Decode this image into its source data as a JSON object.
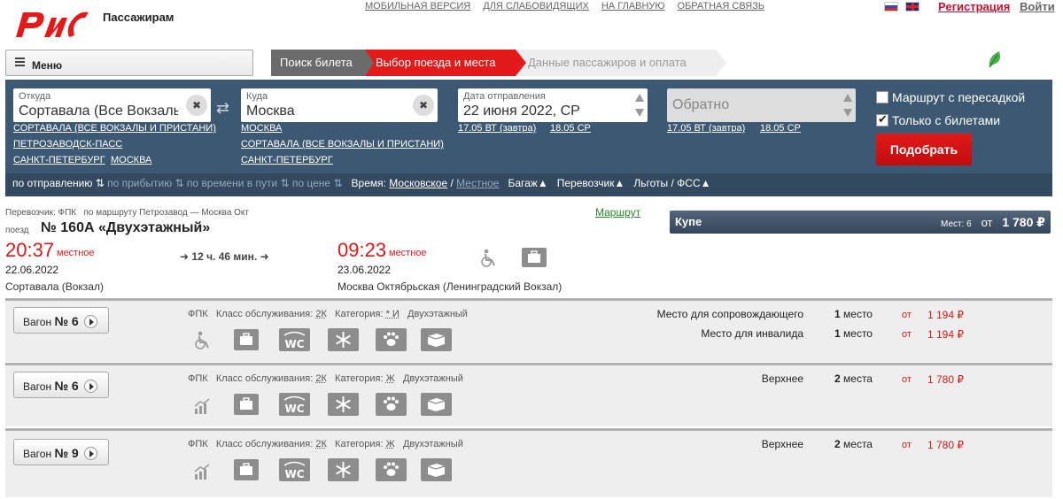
{
  "header": {
    "brand": "Пассажирам",
    "links": [
      "МОБИЛЬНАЯ ВЕРСИЯ",
      "ДЛЯ СЛАБОВИДЯЩИХ",
      "НА ГЛАВНУЮ",
      "ОБРАТНАЯ СВЯЗЬ"
    ],
    "register": "Регистрация",
    "login": "Войти",
    "menu": "Меню"
  },
  "steps": [
    "Поиск билета",
    "Выбор поезда и места",
    "Данные пассажиров и оплата"
  ],
  "search": {
    "from_label": "Откуда",
    "from_value": "Сортавала (Все Вокзалы И",
    "from_suggestions": [
      "СОРТАВАЛА (ВСЕ ВОКЗАЛЫ И ПРИСТАНИ)",
      "ПЕТРОЗАВОДСК-ПАСС",
      "САНКТ-ПЕТЕРБУРГ",
      "МОСКВА"
    ],
    "to_label": "Куда",
    "to_value": "Москва",
    "to_suggestions": [
      "МОСКВА",
      "СОРТАВАЛА (ВСЕ ВОКЗАЛЫ И ПРИСТАНИ)",
      "САНКТ-ПЕТЕРБУРГ"
    ],
    "date_label": "Дата отправления",
    "date_value": "22 июня 2022, СР",
    "date_suggestions": [
      "17.05 ВТ (завтра)",
      "18.05 СР"
    ],
    "back_placeholder": "Обратно",
    "back_suggestions": [
      "17.05 ВТ (завтра)",
      "18.05 СР"
    ],
    "transfer_label": "Маршрут с пересадкой",
    "tickets_only_label": "Только с билетами",
    "find_button": "Подобрать"
  },
  "sortbar": {
    "by_departure": "по отправлению",
    "by_arrival": "по прибытию",
    "by_travel_time": "по времени в пути",
    "by_price": "по цене",
    "time_label": "Время:",
    "time_moscow": "Московское",
    "time_local": "Местное",
    "baggage": "Багаж",
    "carrier": "Перевозчик",
    "benefits": "Льготы / ФСС"
  },
  "train": {
    "carrier_route": "Перевозчик: ФПК   по маршруту Петрозавод — Москва Окт",
    "route_link": "Маршрут",
    "train_prefix": "поезд",
    "train_name": "№ 160А «Двухэтажный»",
    "dep_time": "20:37",
    "dep_tz": "местное",
    "dep_date": "22.06.2022",
    "dep_station": "Сортавала (Вокзал)",
    "duration": "12 ч. 46 мин.",
    "arr_time": "09:23",
    "arr_tz": "местное",
    "arr_date": "23.06.2022",
    "arr_station": "Москва Октябрьская (Ленинградский Вокзал)"
  },
  "coupe": {
    "title": "Купе",
    "seats_label": "Мест: 6",
    "from_label": "от",
    "price": "1 780 ₽"
  },
  "wagons": [
    {
      "label": "Вагон",
      "number": "№ 6",
      "carrier": "ФПК",
      "class_label": "Класс обслуживания:",
      "class_value": "2К",
      "category_label": "Категория:",
      "category_value": "* И",
      "type": "Двухэтажный",
      "seats": [
        {
          "name": "Место для сопровождающего",
          "count": "1 место",
          "from": "от",
          "price": "1 194 ₽"
        },
        {
          "name": "Место для инвалида",
          "count": "1 место",
          "from": "от",
          "price": "1 194 ₽"
        }
      ]
    },
    {
      "label": "Вагон",
      "number": "№ 6",
      "carrier": "ФПК",
      "class_label": "Класс обслуживания:",
      "class_value": "2К",
      "category_label": "Категория:",
      "category_value": "Ж",
      "type": "Двухэтажный",
      "seats": [
        {
          "name": "Верхнее",
          "count": "2 места",
          "from": "от",
          "price": "1 780 ₽"
        }
      ]
    },
    {
      "label": "Вагон",
      "number": "№ 9",
      "carrier": "ФПК",
      "class_label": "Класс обслуживания:",
      "class_value": "2К",
      "category_label": "Категория:",
      "category_value": "Ж",
      "type": "Двухэтажный",
      "seats": [
        {
          "name": "Верхнее",
          "count": "2 места",
          "from": "от",
          "price": "1 780 ₽"
        }
      ]
    }
  ]
}
